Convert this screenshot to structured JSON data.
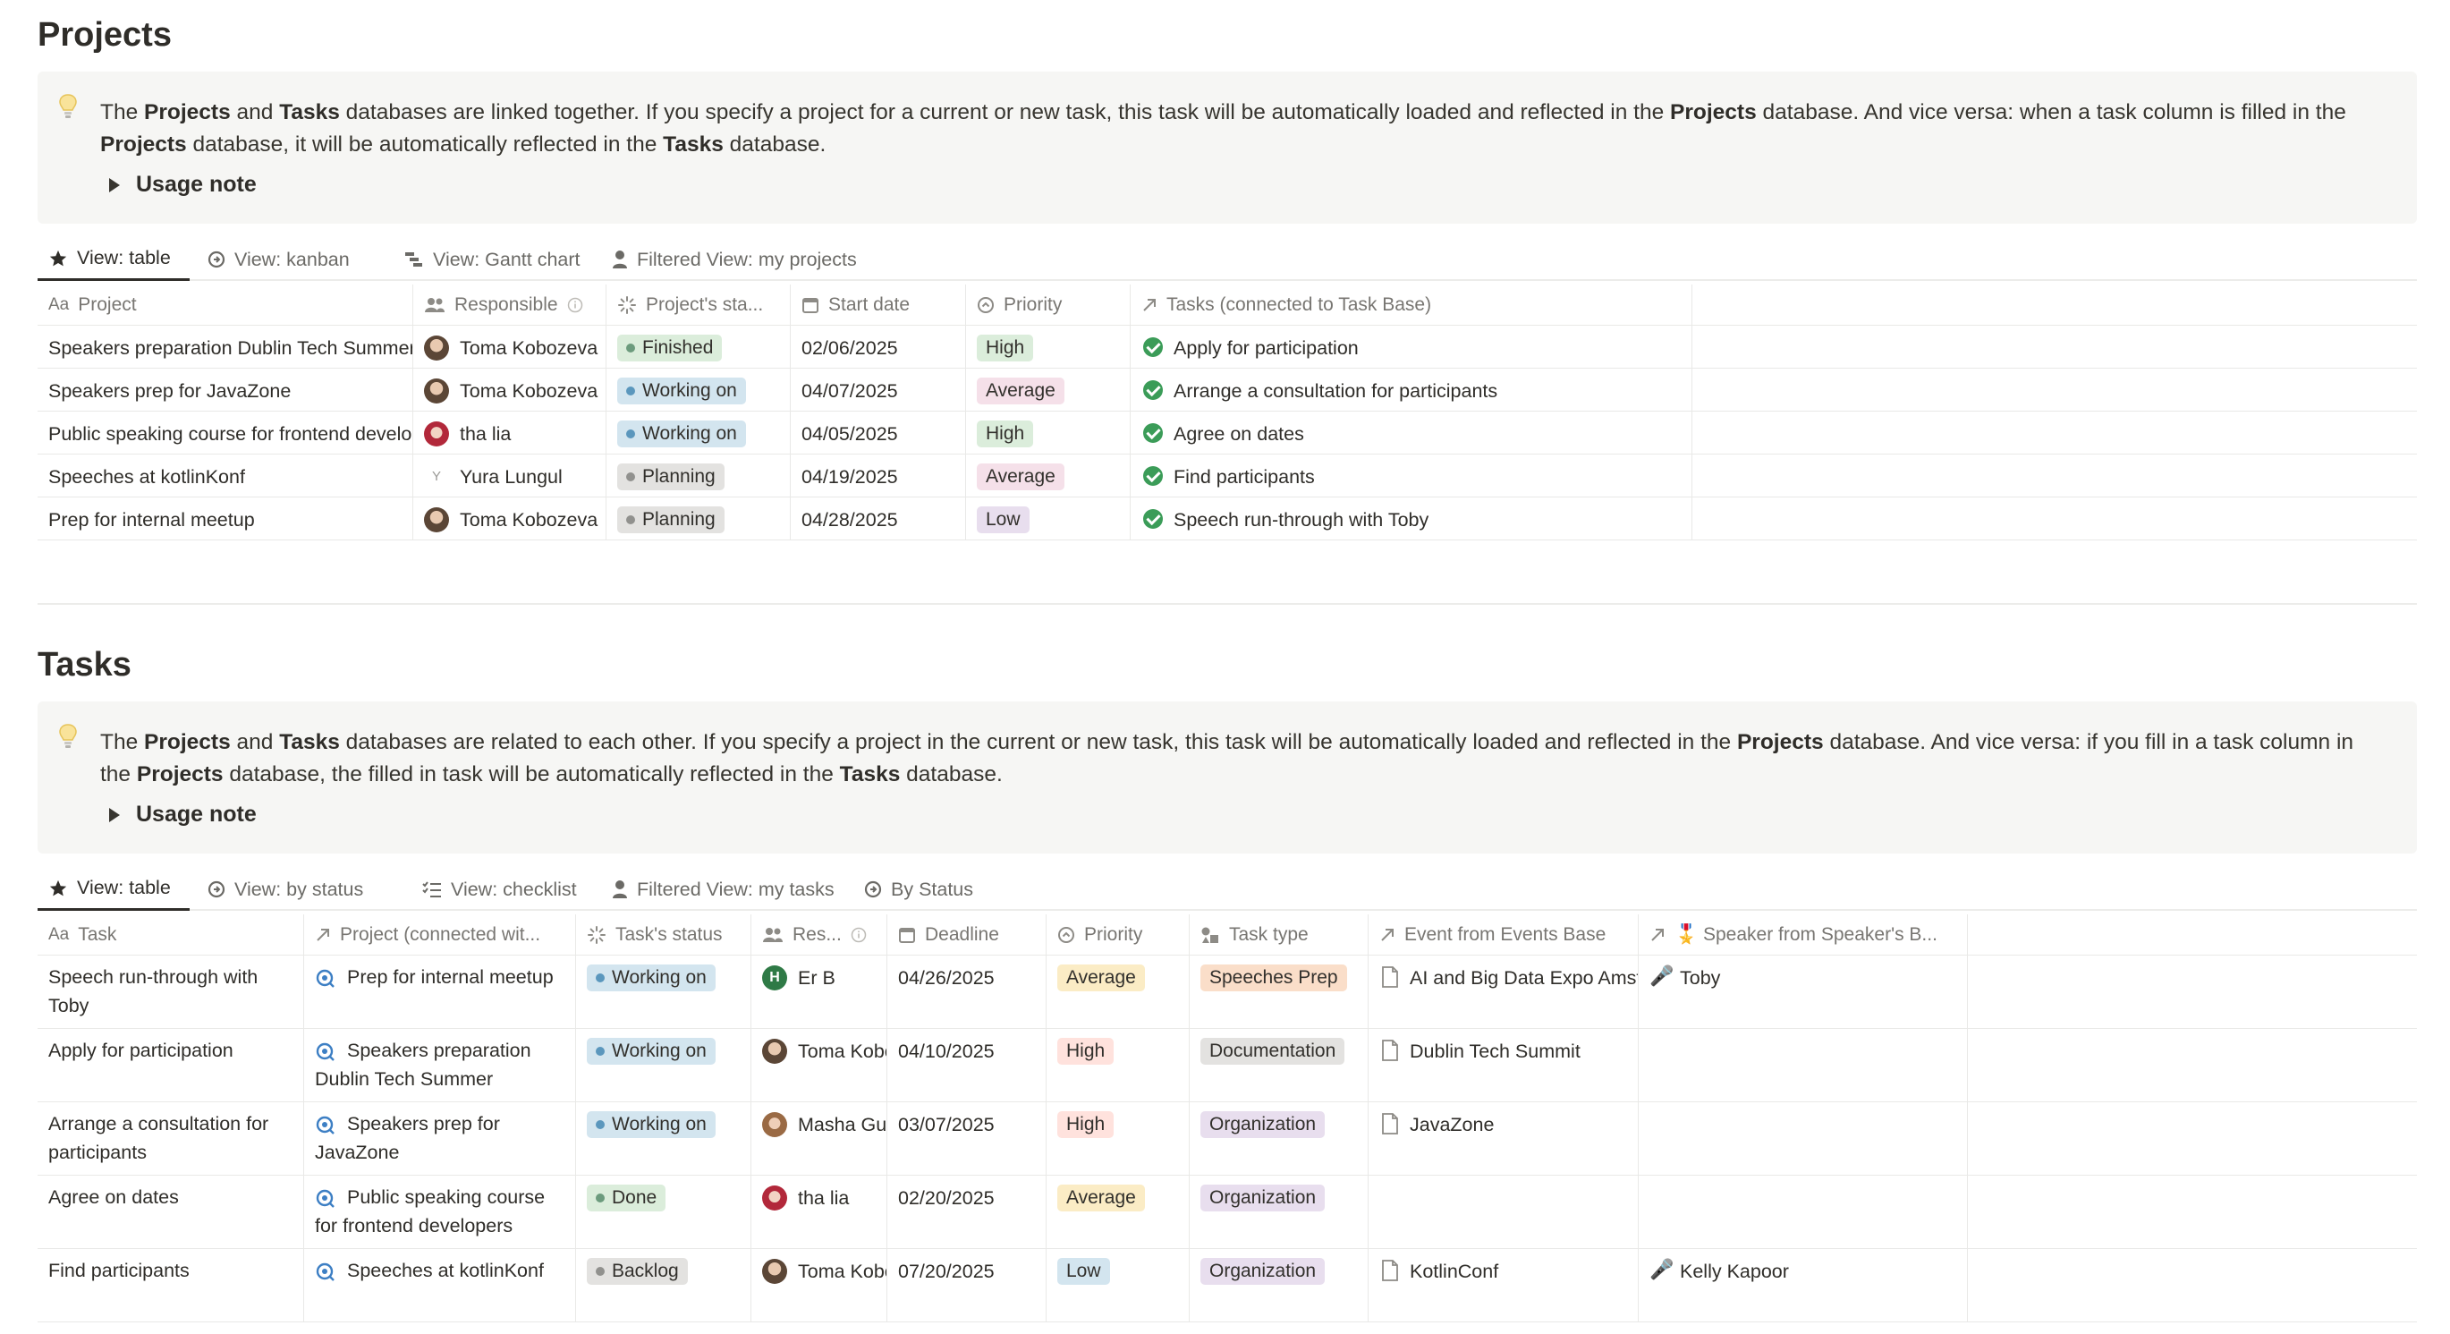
{
  "projects": {
    "title": "Projects",
    "callout": {
      "parts": [
        {
          "t": "The ",
          "b": false
        },
        {
          "t": "Projects",
          "b": true
        },
        {
          "t": " and ",
          "b": false
        },
        {
          "t": "Tasks",
          "b": true
        },
        {
          "t": " databases are linked together. If you specify a project for a current or new task, this task will be automatically loaded and reflected in the ",
          "b": false
        },
        {
          "t": "Projects",
          "b": true
        },
        {
          "t": " database. And vice versa: when a task column is filled in the ",
          "b": false
        },
        {
          "t": "Projects",
          "b": true
        },
        {
          "t": " database, it will be automatically reflected in the ",
          "b": false
        },
        {
          "t": "Tasks",
          "b": true
        },
        {
          "t": " database.",
          "b": false
        }
      ],
      "usage_note": "Usage note"
    },
    "tabs": [
      "View: table",
      "View: kanban",
      "View: Gantt chart",
      "Filtered View: my projects"
    ],
    "headers": [
      "Project",
      "Responsible",
      "Project's sta...",
      "Start date",
      "Priority",
      "Tasks (connected to Task Base)"
    ],
    "header_prefix": "Aa",
    "rows": [
      {
        "project": "Speakers preparation Dublin Tech Summer",
        "responsible": "Toma Kobozeva",
        "avatar": "photo-a",
        "status": "Finished",
        "status_kind": "green",
        "date": "02/06/2025",
        "priority": "High",
        "priority_kind": "green",
        "task": "Apply for participation"
      },
      {
        "project": "Speakers prep for JavaZone",
        "responsible": "Toma Kobozeva",
        "avatar": "photo-a",
        "status": "Working on",
        "status_kind": "blue",
        "date": "04/07/2025",
        "priority": "Average",
        "priority_kind": "pink",
        "task": "Arrange a consultation for participants"
      },
      {
        "project": "Public speaking course for frontend developers",
        "responsible": "tha lia",
        "avatar": "photo-b",
        "status": "Working on",
        "status_kind": "blue",
        "date": "04/05/2025",
        "priority": "High",
        "priority_kind": "green",
        "task": "Agree on dates"
      },
      {
        "project": "Speeches at kotlinKonf",
        "responsible": "Yura Lungul",
        "avatar": "letter-y",
        "avatar_letter": "Y",
        "status": "Planning",
        "status_kind": "gray",
        "date": "04/19/2025",
        "priority": "Average",
        "priority_kind": "pink",
        "task": "Find participants"
      },
      {
        "project": "Prep for internal meetup",
        "responsible": "Toma Kobozeva",
        "avatar": "photo-a",
        "status": "Planning",
        "status_kind": "gray",
        "date": "04/28/2025",
        "priority": "Low",
        "priority_kind": "purple",
        "task": "Speech run-through with Toby"
      }
    ]
  },
  "tasks": {
    "title": "Tasks",
    "callout": {
      "parts": [
        {
          "t": "The ",
          "b": false
        },
        {
          "t": "Projects",
          "b": true
        },
        {
          "t": " and ",
          "b": false
        },
        {
          "t": "Tasks",
          "b": true
        },
        {
          "t": " databases are related to each other. If you specify a project in the current or new task, this task will be automatically loaded and reflected in the ",
          "b": false
        },
        {
          "t": "Projects",
          "b": true
        },
        {
          "t": " database. And vice versa: if you fill in a task column in the ",
          "b": false
        },
        {
          "t": "Projects",
          "b": true
        },
        {
          "t": " database, the filled in task will be automatically reflected in the ",
          "b": false
        },
        {
          "t": "Tasks",
          "b": true
        },
        {
          "t": " database.",
          "b": false
        }
      ],
      "usage_note": "Usage note"
    },
    "tabs": [
      "View: table",
      "View: by status",
      "View: checklist",
      "Filtered View: my tasks",
      "By Status"
    ],
    "headers": [
      "Task",
      "Project (connected wit...",
      "Task's status",
      "Res...",
      "Deadline",
      "Priority",
      "Task type",
      "Event from Events Base",
      "🎖️ Speaker from Speaker's B..."
    ],
    "header_prefix": "Aa",
    "rows": [
      {
        "task": "Speech run-through with Toby",
        "project": "Prep for internal meetup",
        "status": "Working on",
        "status_kind": "blue",
        "responsible": "Er B",
        "avatar": "letter-h",
        "avatar_letter": "H",
        "deadline": "04/26/2025",
        "priority": "Average",
        "priority_kind": "yellow",
        "type": "Speeches Prep",
        "type_kind": "peach",
        "event": "AI and Big Data Expo Amsterdam",
        "speaker": "Toby"
      },
      {
        "task": "Apply for participation",
        "project": "Speakers preparation Dublin Tech Summer",
        "status": "Working on",
        "status_kind": "blue",
        "responsible": "Toma Kobozeva",
        "avatar": "photo-a",
        "deadline": "04/10/2025",
        "priority": "High",
        "priority_kind": "red",
        "type": "Documentation",
        "type_kind": "gray",
        "event": "Dublin Tech Summit",
        "speaker": ""
      },
      {
        "task": "Arrange a consultation for participants",
        "project": "Speakers prep for JavaZone",
        "status": "Working on",
        "status_kind": "blue",
        "responsible": "Masha Gurova",
        "avatar": "photo-c",
        "deadline": "03/07/2025",
        "priority": "High",
        "priority_kind": "red",
        "type": "Organization",
        "type_kind": "purple",
        "event": "JavaZone",
        "speaker": ""
      },
      {
        "task": "Agree on dates",
        "project": "Public speaking course for frontend developers",
        "status": "Done",
        "status_kind": "green",
        "responsible": "tha lia",
        "avatar": "photo-b",
        "deadline": "02/20/2025",
        "priority": "Average",
        "priority_kind": "yellow",
        "type": "Organization",
        "type_kind": "purple",
        "event": "",
        "speaker": ""
      },
      {
        "task": "Find participants",
        "project": "Speeches at kotlinKonf",
        "status": "Backlog",
        "status_kind": "gray",
        "responsible": "Toma Kobozeva",
        "avatar": "photo-a",
        "deadline": "07/20/2025",
        "priority": "Low",
        "priority_kind": "blue",
        "type": "Organization",
        "type_kind": "purple",
        "event": "KotlinConf",
        "speaker": "Kelly Kapoor"
      }
    ]
  },
  "colors": {
    "pill_green_bg": "#dbeddb",
    "pill_green_dot": "#6c9b7d",
    "pill_blue_bg": "#d3e5ef",
    "pill_blue_dot": "#5b97bd",
    "pill_gray_bg": "#e3e2e0",
    "pill_gray_dot": "#91918e",
    "pill_pink_bg": "#f5e0e9",
    "pill_purple_bg": "#e8deee",
    "pill_yellow_bg": "#fbecc5",
    "pill_red_bg": "#ffe2dd",
    "pill_peach_bg": "#fadec9"
  }
}
